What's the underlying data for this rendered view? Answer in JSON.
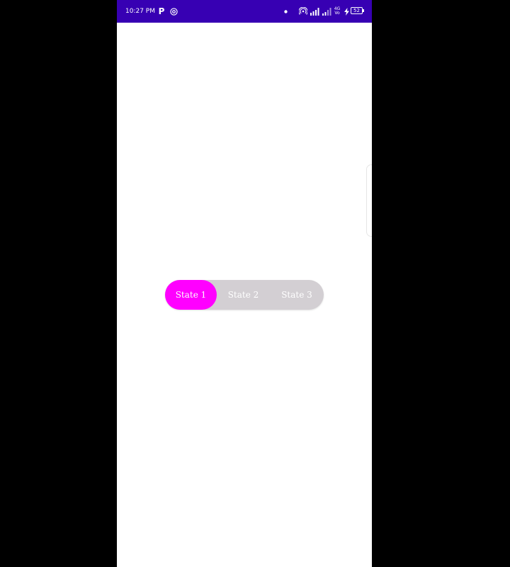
{
  "status_bar": {
    "time": "10:27 PM",
    "icon_p": "P",
    "data_type_top": "4G",
    "data_type_bottom": "Vo",
    "battery": "52",
    "background_color": "#3700b3"
  },
  "icons": {
    "p": "parking-app-icon",
    "at": "at-sign-icon",
    "dot": "notification-dot-icon",
    "hotspot": "hotspot-icon",
    "signal1": "signal-bars-icon",
    "signal2": "signal-bars-icon",
    "charging": "charging-bolt-icon"
  },
  "segmented_control": {
    "selected_index": 0,
    "active_color": "#ff00ff",
    "track_color": "#d3cfd3",
    "items": [
      {
        "label": "State 1"
      },
      {
        "label": "State 2"
      },
      {
        "label": "State 3"
      }
    ]
  }
}
